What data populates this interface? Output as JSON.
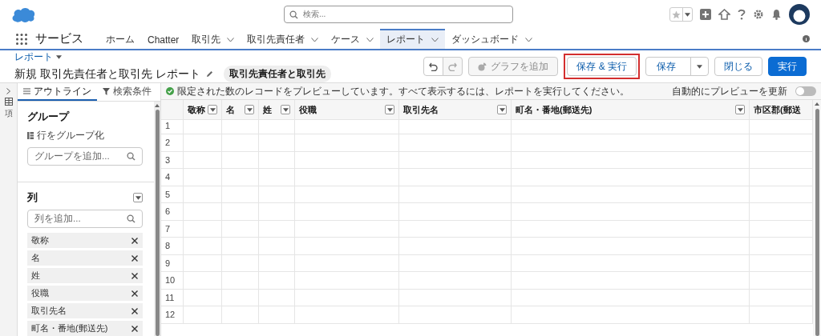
{
  "header": {
    "search": {
      "placeholder": "検索..."
    }
  },
  "nav": {
    "app_name": "サービス",
    "tabs": [
      {
        "label": "ホーム",
        "menu": false,
        "selected": false
      },
      {
        "label": "Chatter",
        "menu": false,
        "selected": false
      },
      {
        "label": "取引先",
        "menu": true,
        "selected": false
      },
      {
        "label": "取引先責任者",
        "menu": true,
        "selected": false
      },
      {
        "label": "ケース",
        "menu": true,
        "selected": false
      },
      {
        "label": "レポート",
        "menu": true,
        "selected": true
      },
      {
        "label": "ダッシュボード",
        "menu": true,
        "selected": false
      }
    ]
  },
  "page_header": {
    "breadcrumb": "レポート",
    "title": "新規 取引先責任者と取引先 レポート",
    "report_type": "取引先責任者と取引先",
    "buttons": [
      {
        "kind": "undo",
        "disabled": false,
        "highlighted": false
      },
      {
        "kind": "redo",
        "disabled": true,
        "highlighted": false
      },
      {
        "kind": "chart",
        "label": "グラフを追加",
        "disabled": true,
        "highlighted": false
      },
      {
        "kind": "neutral",
        "label": "保存 & 実行",
        "disabled": false,
        "highlighted": true
      },
      {
        "kind": "split",
        "label": "保存",
        "disabled": false,
        "highlighted": false
      },
      {
        "kind": "neutral",
        "label": "閉じる",
        "disabled": false,
        "highlighted": false
      },
      {
        "kind": "brand",
        "label": "実行",
        "disabled": false,
        "highlighted": false
      }
    ]
  },
  "side_strip": {
    "label": "項"
  },
  "outline": {
    "tabs": [
      {
        "label": "アウトライン",
        "selected": true
      },
      {
        "label": "検索条件",
        "selected": false
      }
    ],
    "groups": {
      "heading": "グループ",
      "hint": "行をグループ化",
      "placeholder": "グループを追加..."
    },
    "columns": {
      "heading": "列",
      "placeholder": "列を追加...",
      "items": [
        "敬称",
        "名",
        "姓",
        "役職",
        "取引先名",
        "町名・番地(郵送先)"
      ]
    }
  },
  "preview": {
    "message": "限定された数のレコードをプレビューしています。すべて表示するには、レポートを実行してください。",
    "auto_update": {
      "label": "自動的にプレビューを更新",
      "on": false
    }
  },
  "table": {
    "columns": [
      {
        "label": "敬称",
        "filter": true
      },
      {
        "label": "名",
        "filter": true
      },
      {
        "label": "姓",
        "filter": true
      },
      {
        "label": "役職",
        "filter": true
      },
      {
        "label": "取引先名",
        "filter": true
      },
      {
        "label": "町名・番地(郵送先)",
        "filter": true
      },
      {
        "label": "市区郡(郵送",
        "filter": false
      }
    ],
    "rows": [
      "1",
      "2",
      "3",
      "4",
      "5",
      "6",
      "7",
      "8",
      "9",
      "10",
      "11",
      "12"
    ]
  }
}
